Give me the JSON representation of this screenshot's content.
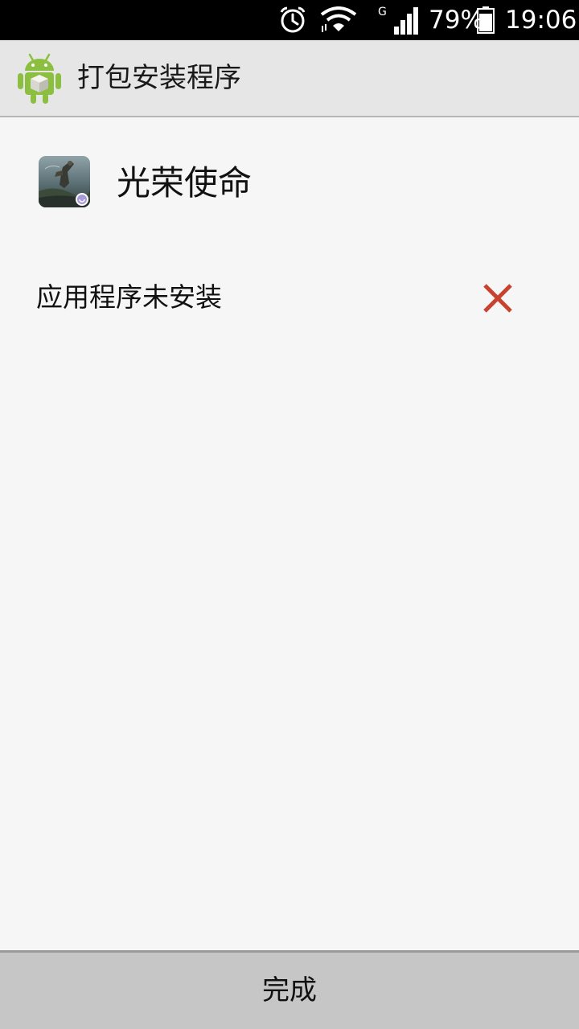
{
  "status_bar": {
    "battery_percent": "79%",
    "time": "19:06",
    "network_type": "G",
    "icons": [
      "alarm-icon",
      "wifi-icon",
      "cell-signal-icon",
      "battery-icon"
    ]
  },
  "action_bar": {
    "title": "打包安装程序",
    "logo_icon": "android-package-icon"
  },
  "app": {
    "name": "光荣使命",
    "icon": "game-app-icon"
  },
  "install_status": {
    "message": "应用程序未安装",
    "icon": "failed-x-icon",
    "icon_color": "#c8432f"
  },
  "footer": {
    "done_label": "完成"
  }
}
